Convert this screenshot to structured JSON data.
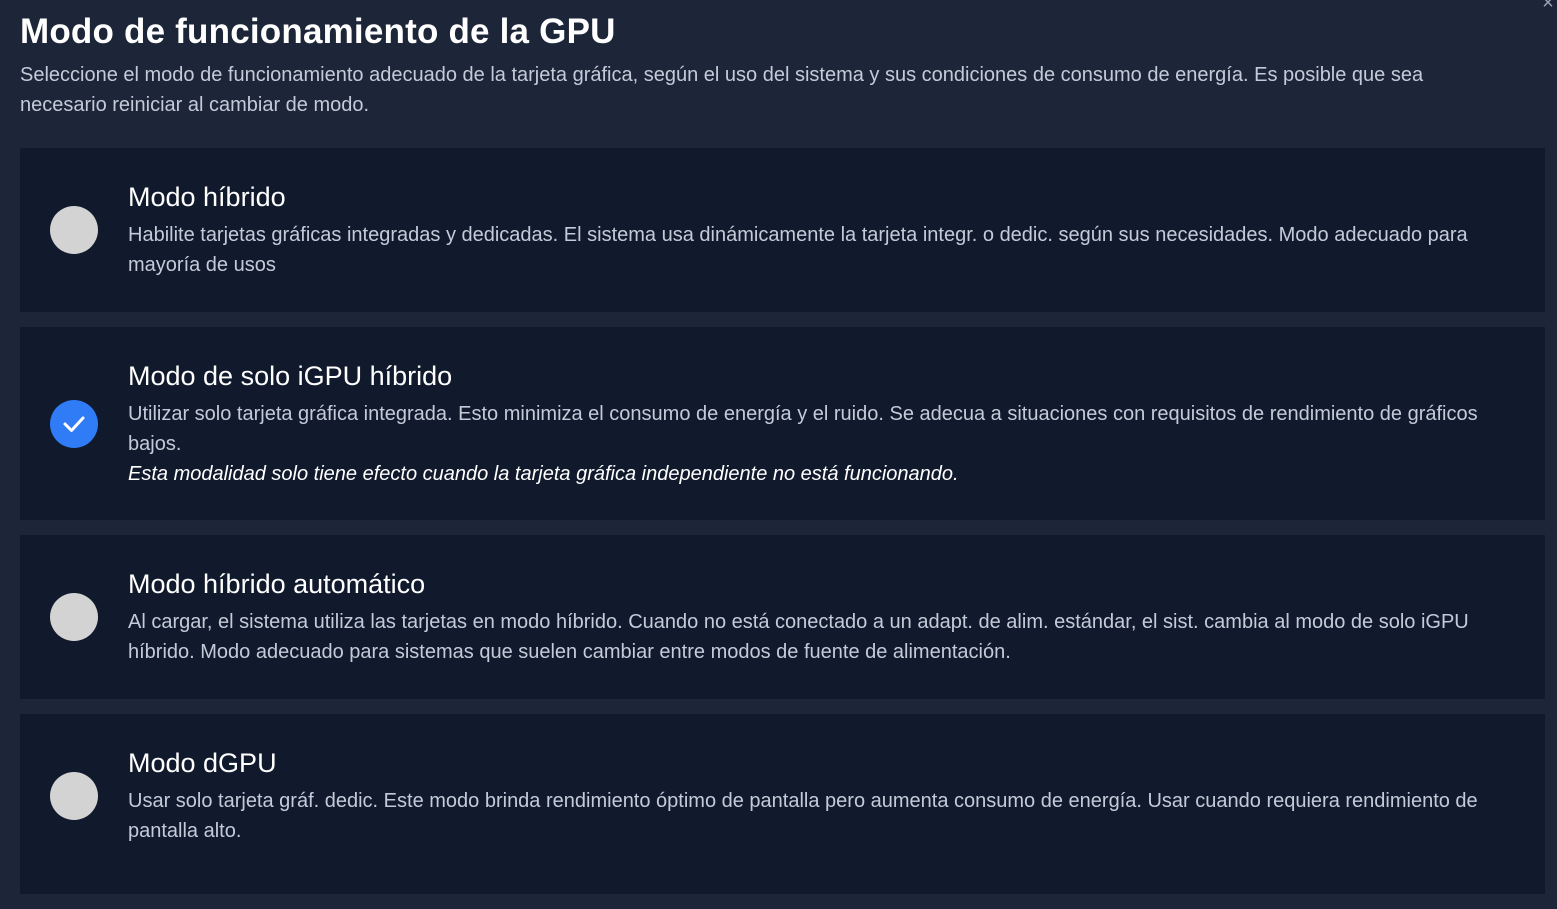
{
  "dialog": {
    "title": "Modo de funcionamiento de la GPU",
    "subtitle": "Seleccione el modo de funcionamiento adecuado de la tarjeta gráfica, según el uso del sistema y sus condiciones de consumo de energía. Es posible que sea necesario reiniciar al cambiar de modo.",
    "close_icon": "close-icon"
  },
  "options": [
    {
      "title": "Modo híbrido",
      "description": "Habilite tarjetas gráficas integradas y dedicadas. El sistema usa dinámicamente la tarjeta integr. o dedic. según sus necesidades. Modo adecuado para mayoría de usos",
      "selected": false
    },
    {
      "title": "Modo de solo iGPU híbrido",
      "description": "Utilizar solo tarjeta gráfica integrada. Esto minimiza el consumo de energía y el ruido. Se adecua a situaciones con requisitos de rendimiento de gráficos bajos.",
      "note": "Esta modalidad solo tiene efecto cuando la tarjeta gráfica independiente no está funcionando.",
      "selected": true
    },
    {
      "title": "Modo híbrido automático",
      "description": "Al cargar, el sistema utiliza las tarjetas en modo híbrido. Cuando no está conectado a un adapt. de alim. estándar, el sist. cambia al modo de solo iGPU híbrido. Modo adecuado para sistemas que suelen cambiar entre modos de fuente de alimentación.",
      "selected": false
    },
    {
      "title": "Modo dGPU",
      "description": "Usar solo tarjeta gráf. dedic. Este modo brinda rendimiento óptimo de pantalla pero aumenta consumo de energía. Usar cuando requiera rendimiento de pantalla alto.",
      "selected": false
    }
  ],
  "colors": {
    "background": "#1d2538",
    "card": "#111a2d",
    "accent": "#2f7cf6",
    "radio_unchecked": "#d3d3d3",
    "text_secondary": "#c4cbd8"
  }
}
